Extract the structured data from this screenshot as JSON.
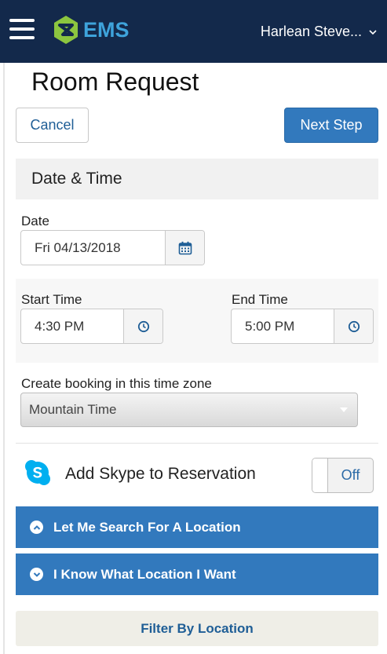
{
  "header": {
    "logo_text": "EMS",
    "user_name": "Harlean Steve..."
  },
  "page": {
    "title": "Room Request",
    "cancel_label": "Cancel",
    "next_label": "Next Step"
  },
  "section": {
    "title": "Date & Time"
  },
  "date": {
    "label": "Date",
    "value": "Fri 04/13/2018"
  },
  "start_time": {
    "label": "Start Time",
    "value": "4:30 PM"
  },
  "end_time": {
    "label": "End Time",
    "value": "5:00 PM"
  },
  "timezone": {
    "label": "Create booking in this time zone",
    "selected": "Mountain Time"
  },
  "skype": {
    "label": "Add Skype to Reservation",
    "toggle_state": "Off"
  },
  "accordions": [
    {
      "label": "Let Me Search For A Location",
      "icon": "chevron-up-icon"
    },
    {
      "label": "I Know What Location I Want",
      "icon": "chevron-down-icon"
    }
  ],
  "filter": {
    "label": "Filter By Location"
  },
  "colors": {
    "header_bg": "#13294b",
    "accent_blue": "#3279bd",
    "logo_green": "#8cc63f",
    "logo_blue": "#3ea3db",
    "skype_blue": "#00aff0"
  }
}
